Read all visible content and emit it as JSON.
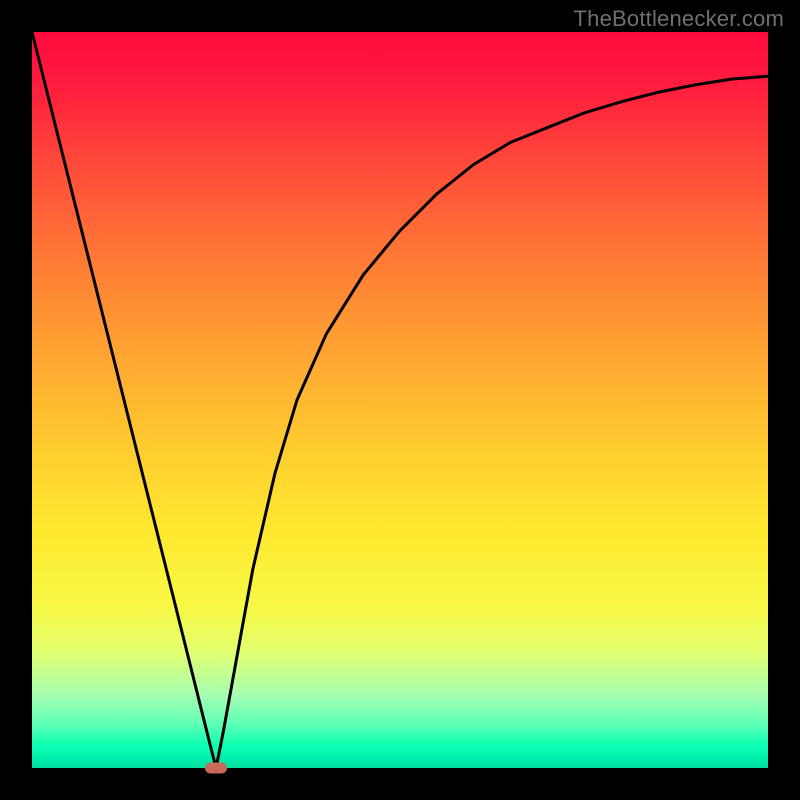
{
  "watermark": "TheBottlenecker.com",
  "chart_data": {
    "type": "line",
    "title": "",
    "xlabel": "",
    "ylabel": "",
    "xlim": [
      0,
      100
    ],
    "ylim": [
      0,
      100
    ],
    "x": [
      0,
      5,
      10,
      15,
      20,
      22,
      24,
      25,
      26,
      28,
      30,
      33,
      36,
      40,
      45,
      50,
      55,
      60,
      65,
      70,
      75,
      80,
      85,
      90,
      95,
      100
    ],
    "y": [
      100,
      80,
      60,
      40,
      20,
      12,
      4,
      0,
      5,
      16,
      27,
      40,
      50,
      59,
      67,
      73,
      78,
      82,
      85,
      87,
      89,
      90.5,
      91.8,
      92.8,
      93.6,
      94
    ],
    "marker": {
      "x": 25,
      "y": 0
    },
    "gradient_stops": [
      {
        "pct": 0,
        "color": "#ff0a3f"
      },
      {
        "pct": 50,
        "color": "#ffd02f"
      },
      {
        "pct": 80,
        "color": "#f7f845"
      },
      {
        "pct": 100,
        "color": "#00f3af"
      }
    ]
  }
}
